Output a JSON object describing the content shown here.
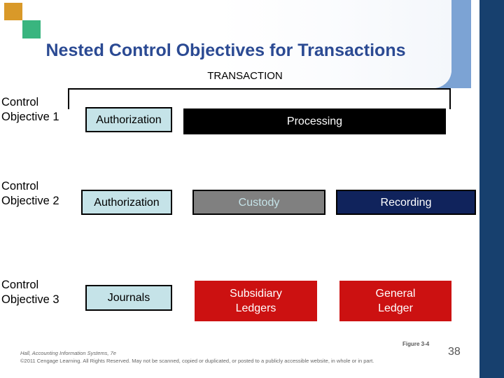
{
  "slide": {
    "title": "Nested Control Objectives for Transactions",
    "transaction_label": "TRANSACTION",
    "page_number": "38",
    "figure_caption": "Figure 3-4"
  },
  "rows": [
    {
      "label_line1": "Control",
      "label_line2": "Objective 1",
      "boxes": [
        {
          "name": "authorization",
          "text": "Authorization",
          "style": "cyan"
        },
        {
          "name": "processing",
          "text": "Processing",
          "style": "black"
        }
      ]
    },
    {
      "label_line1": "Control",
      "label_line2": "Objective 2",
      "boxes": [
        {
          "name": "authorization",
          "text": "Authorization",
          "style": "cyan"
        },
        {
          "name": "custody",
          "text": "Custody",
          "style": "gray"
        },
        {
          "name": "recording",
          "text": "Recording",
          "style": "navy"
        }
      ]
    },
    {
      "label_line1": "Control",
      "label_line2": "Objective 3",
      "boxes": [
        {
          "name": "journals",
          "text": "Journals",
          "style": "cyan"
        },
        {
          "name": "subsidiary-ledgers",
          "line1": "Subsidiary",
          "line2": "Ledgers",
          "style": "red"
        },
        {
          "name": "general-ledger",
          "line1": "General",
          "line2": "Ledger",
          "style": "red"
        }
      ]
    }
  ],
  "footer": {
    "source": "Hall, Accounting Information Systems, 7e",
    "copyright": "©2011 Cengage Learning. All Rights Reserved. May not be scanned, copied or duplicated, or posted to a publicly accessible website, in whole or in part."
  },
  "colors": {
    "title_blue": "#2b4a93",
    "band_light_blue": "#7ca3d4",
    "bar_dark_blue": "#17406e",
    "square_orange": "#d99929",
    "square_green": "#39b57f",
    "box_cyan": "#c5e3e8",
    "box_black": "#000000",
    "box_gray": "#808080",
    "box_navy": "#10235c",
    "box_red": "#cc1111"
  }
}
